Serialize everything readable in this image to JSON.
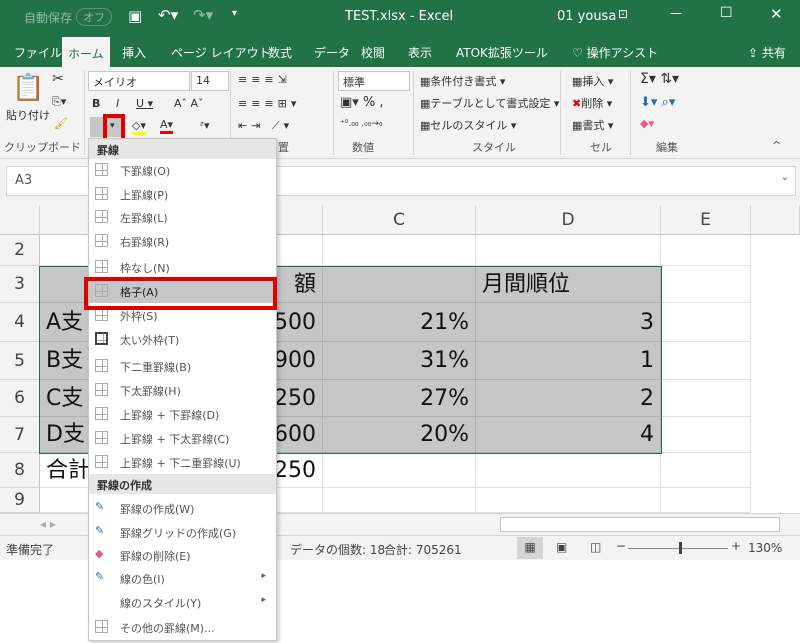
{
  "title_bar": {
    "autosave": "自動保存",
    "autosave_state": "オフ",
    "title": "TEST.xlsx  -  Excel",
    "user": "01 yousa"
  },
  "tabs": [
    "ファイル",
    "ホーム",
    "挿入",
    "ページ レイアウト",
    "数式",
    "データ",
    "校閲",
    "表示",
    "ATOK拡張ツール"
  ],
  "tell_me": "操作アシスト",
  "share": "共有",
  "ribbon": {
    "paste": "貼り付け",
    "font": "メイリオ",
    "size": "14",
    "number_format": "標準",
    "conditional": "条件付き書式",
    "table": "テーブルとして書式設定",
    "cell_style": "セルのスタイル",
    "insert": "挿入",
    "delete": "削除",
    "format": "書式",
    "groups": [
      "クリップボード",
      "置",
      "数値",
      "スタイル",
      "セル",
      "編集"
    ]
  },
  "name_box": "A3",
  "columns": [
    "A",
    "C",
    "D",
    "E"
  ],
  "rows": [
    "2",
    "3",
    "4",
    "5",
    "6",
    "7",
    "8",
    "9"
  ],
  "cells": {
    "a": [
      "",
      "",
      "A支",
      "B支",
      "C支",
      "D支",
      "合計",
      ""
    ],
    "b": [
      "",
      "額",
      "500",
      "900",
      "250",
      "600",
      "250",
      ""
    ],
    "c": [
      "",
      "",
      "21%",
      "31%",
      "27%",
      "20%",
      "",
      ""
    ],
    "d": [
      "",
      "月間順位",
      "3",
      "1",
      "2",
      "4",
      "",
      ""
    ]
  },
  "status": {
    "ready": "準備完了",
    "count": "データの個数: 18",
    "sum": "合計: 705261",
    "zoom": "130%"
  },
  "menu": {
    "header1": "罫線",
    "items1": [
      "下罫線(O)",
      "上罫線(P)",
      "左罫線(L)",
      "右罫線(R)",
      "枠なし(N)",
      "格子(A)",
      "外枠(S)",
      "太い外枠(T)",
      "下二重罫線(B)",
      "下太罫線(H)",
      "上罫線 + 下罫線(D)",
      "上罫線 + 下太罫線(C)",
      "上罫線 + 下二重罫線(U)"
    ],
    "header2": "罫線の作成",
    "items2": [
      "罫線の作成(W)",
      "罫線グリッドの作成(G)",
      "罫線の削除(E)",
      "線の色(I)",
      "線のスタイル(Y)",
      "その他の罫線(M)..."
    ],
    "highlighted": "格子(A)"
  },
  "colors": {
    "excel_green": "#217346",
    "highlight": "#e00000"
  }
}
